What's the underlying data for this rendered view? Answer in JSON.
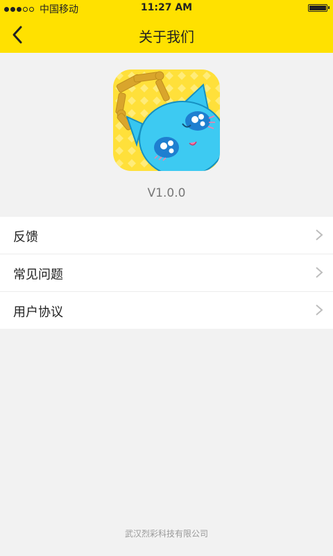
{
  "status_bar": {
    "signal_icon": "signal-dots-icon",
    "carrier": "中国移动",
    "time": "11:27 AM",
    "battery_icon": "battery-icon"
  },
  "navbar": {
    "back_icon": "chevron-left-icon",
    "title": "关于我们"
  },
  "app": {
    "version": "V1.0.0"
  },
  "menu": {
    "items": [
      {
        "label": "反馈",
        "icon": "chevron-right-icon"
      },
      {
        "label": "常见问题",
        "icon": "chevron-right-icon"
      },
      {
        "label": "用户协议",
        "icon": "chevron-right-icon"
      }
    ]
  },
  "footer": {
    "company": "武汉烈彩科技有限公司"
  },
  "colors": {
    "accent": "#ffe100",
    "background": "#f2f2f2"
  }
}
